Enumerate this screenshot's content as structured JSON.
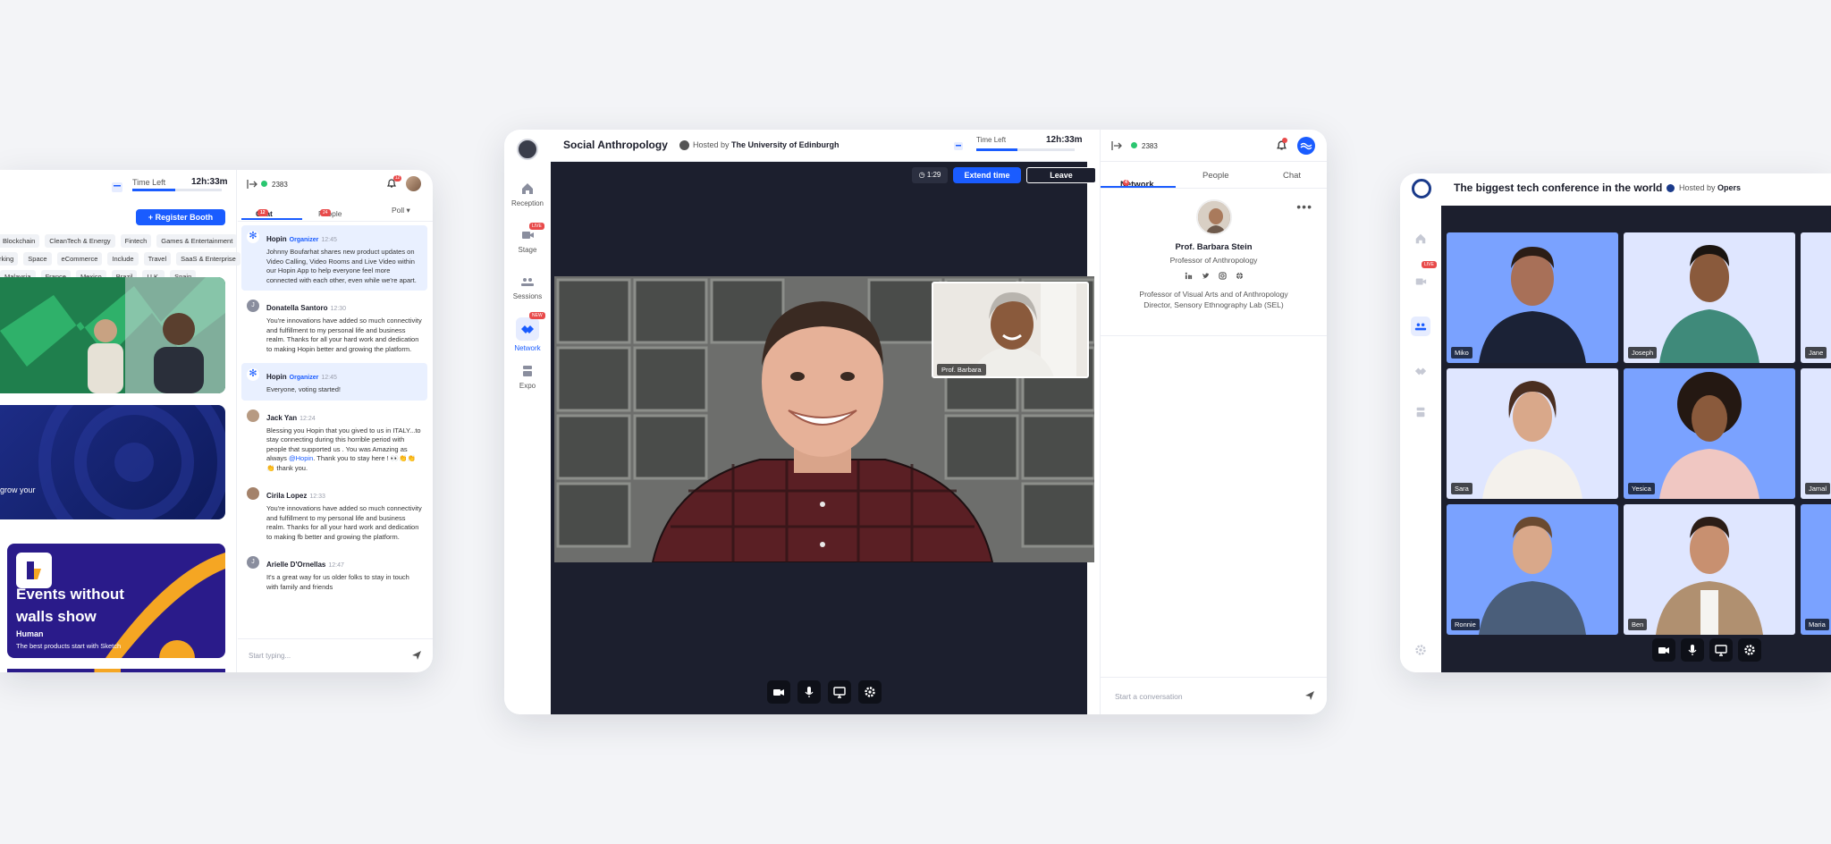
{
  "left_panel": {
    "time_left_label": "Time Left",
    "time_left_value": "12h:33m",
    "time_left_progress": 0.48,
    "register_booth": "+ Register Booth",
    "tags_row1": [
      "Blockchain",
      "CleanTech & Energy",
      "Fintech",
      "Games & Entertainment"
    ],
    "tags_row2": [
      "rking",
      "Space",
      "eCommerce",
      "Include",
      "Travel",
      "SaaS & Enterprise"
    ],
    "tags_row3": [
      "Malaysia",
      "France",
      "Mexico",
      "Brazil",
      "U.K.",
      "Spain"
    ],
    "card2_text": "grow your",
    "card3_title": "Events without walls show",
    "card3_sub": "Human",
    "card3_tagline": "The best products start with Sketch",
    "attendee_count": "2383",
    "bell_badge": "12",
    "tabs": [
      {
        "label": "Chat",
        "badge": "12"
      },
      {
        "label": "People",
        "badge": "24"
      },
      {
        "label": "Poll ▾"
      }
    ],
    "messages": [
      {
        "name": "Hopin",
        "role": "Organizer",
        "time": "12:45",
        "text": "Johnny Boufarhat shares new product updates on Video Calling, Video Rooms and Live Video within our Hopin App to help everyone feel more connected with each other, even while we're apart."
      },
      {
        "name": "Donatella Santoro",
        "time": "12:30",
        "text": "You're innovations have added so much connectivity and fulfillment to my personal life and business realm. Thanks for all your hard work and dedication to making Hopin better and growing the platform."
      },
      {
        "name": "Hopin",
        "role": "Organizer",
        "time": "12:45",
        "text": "Everyone, voting started!"
      },
      {
        "name": "Jack Yan",
        "time": "12:24",
        "text_a": "Blessing you Hopin that you gived to us in ITALY...to stay connecting during this horrible period with people that supported us . You was Amazing as always",
        "mention": "@Hopin",
        "text_b": ". Thank you to stay here ! 👀👏👏👏 thank you."
      },
      {
        "name": "Cirila Lopez",
        "time": "12:33",
        "text": "You're innovations have added so much connectivity and fulfillment to my personal life and business realm. Thanks for all your hard work and dedication to making fb better and growing the platform."
      },
      {
        "name": "Arielle D'Ornellas",
        "time": "12:47",
        "text": "It's a great way for us older folks to stay in touch with family and friends"
      }
    ],
    "input_placeholder": "Start typing..."
  },
  "center_panel": {
    "title": "Social Anthropology",
    "hosted_prefix": "Hosted by",
    "host": "The University of Edinburgh",
    "time_left_label": "Time Left",
    "time_left_value": "12h:33m",
    "time_left_progress": 0.42,
    "nav": [
      {
        "label": "Reception",
        "icon": "home-icon"
      },
      {
        "label": "Stage",
        "icon": "stage-icon",
        "badge": "LIVE"
      },
      {
        "label": "Sessions",
        "icon": "sessions-icon"
      },
      {
        "label": "Network",
        "icon": "network-icon",
        "badge": "NEW"
      },
      {
        "label": "Expo",
        "icon": "expo-icon"
      }
    ],
    "timer": "1:29",
    "extend_button": "Extend time",
    "leave_button": "Leave",
    "pip_name": "Prof. Barbara",
    "attendee_count": "2383",
    "tabs": [
      {
        "label": "Network",
        "badge": "4"
      },
      {
        "label": "People"
      },
      {
        "label": "Chat"
      }
    ],
    "profile_name": "Prof. Barbara Stein",
    "profile_role": "Professor of Anthropology",
    "profile_desc_1": "Professor of Visual Arts and of Anthropology",
    "profile_desc_2": "Director, Sensory Ethnography Lab (SEL)",
    "input_placeholder": "Start a conversation"
  },
  "right_panel": {
    "title": "The biggest tech conference in the world",
    "hosted_prefix": "Hosted by",
    "host": "Opers",
    "live_badge": "LIVE",
    "tiles": [
      {
        "name": "Miko"
      },
      {
        "name": "Joseph"
      },
      {
        "name": "Jane"
      },
      {
        "name": "Sara"
      },
      {
        "name": "Yesica"
      },
      {
        "name": "Jamal"
      },
      {
        "name": "Ronnie"
      },
      {
        "name": "Ben"
      },
      {
        "name": "Maria"
      }
    ]
  },
  "colors": {
    "accent": "#1a5cff",
    "badge": "#e84a4a",
    "stage_bg": "#1c1f2e",
    "tile_blue": "#7aa2ff",
    "tile_light": "#dfe6ff"
  }
}
